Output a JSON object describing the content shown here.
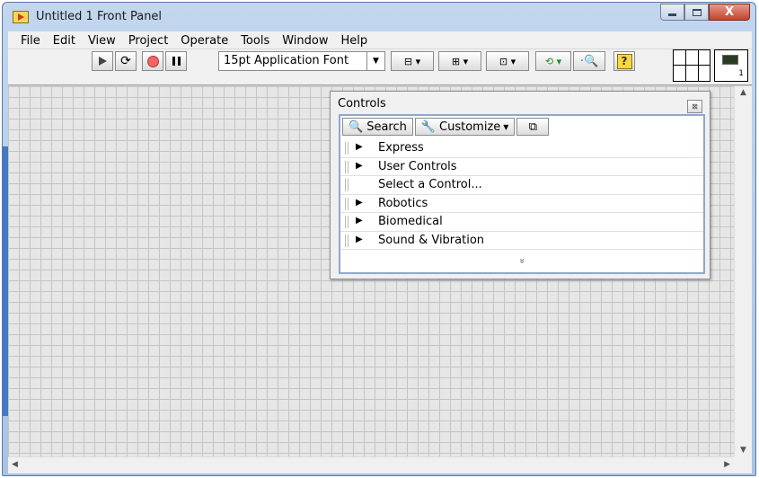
{
  "window": {
    "title": "Untitled 1 Front Panel",
    "minimize": "",
    "maximize": "",
    "close": "X"
  },
  "menu": [
    "File",
    "Edit",
    "View",
    "Project",
    "Operate",
    "Tools",
    "Window",
    "Help"
  ],
  "toolbar": {
    "font": "15pt Application Font",
    "help": "?",
    "vi_icon_number": "1"
  },
  "palette": {
    "title": "Controls",
    "close": "⊠",
    "search": "Search",
    "customize": "Customize",
    "items": [
      {
        "label": "Express",
        "expandable": true
      },
      {
        "label": "User Controls",
        "expandable": true
      },
      {
        "label": "Select a Control...",
        "expandable": false
      },
      {
        "label": "Robotics",
        "expandable": true
      },
      {
        "label": "Biomedical",
        "expandable": true
      },
      {
        "label": "Sound & Vibration",
        "expandable": true
      }
    ],
    "more": "»"
  },
  "colors": {
    "accent": "#3f7ac4",
    "close_button": "#c4422b",
    "grid_line": "#c4c4c4"
  }
}
